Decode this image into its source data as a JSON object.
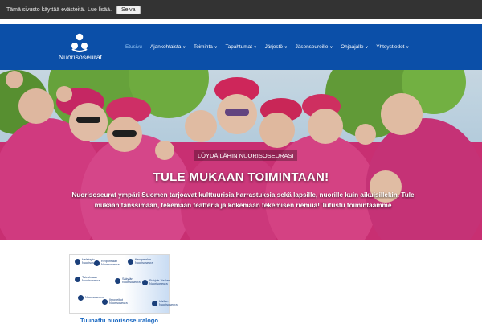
{
  "cookie": {
    "text": "Tämä sivusto käyttää evästeitä.",
    "link": "Lue lisää.",
    "button": "Selva"
  },
  "brand": {
    "name": "Nuorisoseurat",
    "color": "#0b4fa8"
  },
  "nav": {
    "items": [
      {
        "label": "Etusivu",
        "chevron": false
      },
      {
        "label": "Ajankohtaista",
        "chevron": true
      },
      {
        "label": "Toiminta",
        "chevron": true
      },
      {
        "label": "Tapahtumat",
        "chevron": true
      },
      {
        "label": "Järjestö",
        "chevron": true
      },
      {
        "label": "Jäsenseuroille",
        "chevron": true
      },
      {
        "label": "Ohjaajalle",
        "chevron": true
      },
      {
        "label": "Yhteystiedot",
        "chevron": true
      }
    ]
  },
  "hero": {
    "kicker": "LÖYDÄ LÄHIN NUORISOSEURASI",
    "title": "TULE MUKAAN TOIMINTAAN!",
    "description": "Nuorisoseurat ympäri Suomen tarjoavat kulttuurisia harrastuksia sekä lapsille, nuorille kuin aikuisillekin. Tule mukaan tanssimaan, tekemään teatteria ja kokemaan tekemisen riemua! Tutustu toimintaamme"
  },
  "logos": {
    "caption": "Tuunattu nuorisoseuralogo",
    "items": [
      "Helsingin Nuorisoseura",
      "Reiponsaari Nuorisoseura",
      "Kangasalan Nuorisoseura",
      "Taivalmaan Nuorisoseura",
      "Säkylän Nuorisoseura",
      "Pohjois-Vaalan Nuorisoseura",
      "Nuorisoseura",
      "Ilmoveikot Nuorisoseura",
      "Ulvilan Nuorisoseura"
    ]
  }
}
